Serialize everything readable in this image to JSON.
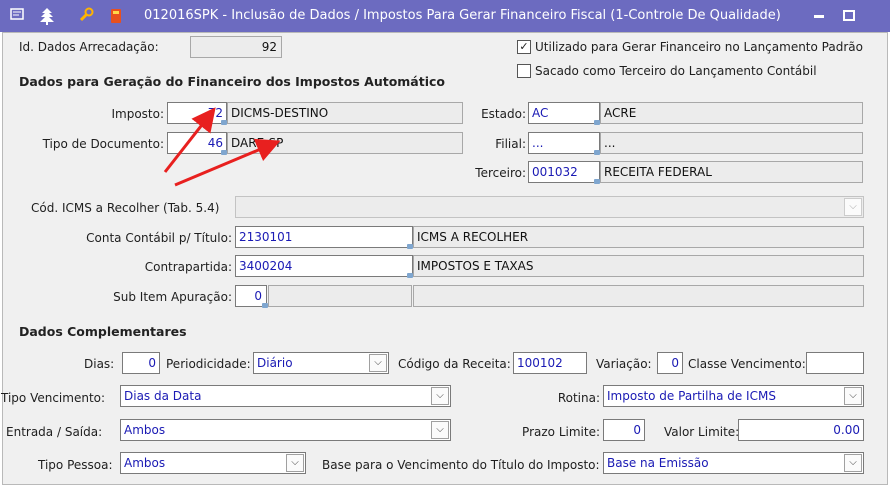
{
  "titlebar": {
    "title": "012016SPK - Inclusão de Dados / Impostos Para Gerar Financeiro Fiscal (1-Controle De Qualidade)",
    "icons": [
      "menu-icon",
      "tree-icon",
      "wrench-icon",
      "book-icon"
    ],
    "bg_color": "#6c6bc0"
  },
  "header": {
    "id_label": "Id. Dados Arrecadação:",
    "id_value": "92",
    "chk_utilizado_label": "Utilizado para Gerar Financeiro no Lançamento Padrão",
    "chk_utilizado_checked": true,
    "chk_sacado_label": "Sacado como Terceiro do Lançamento Contábil",
    "chk_sacado_checked": false
  },
  "auto": {
    "section_title": "Dados para Geração do Financeiro dos Impostos Automático",
    "imposto_label": "Imposto:",
    "imposto_code": "72",
    "imposto_desc": "DICMS-DESTINO",
    "tipodoc_label": "Tipo de Documento:",
    "tipodoc_code": "46",
    "tipodoc_desc": "DARE-SP",
    "estado_label": "Estado:",
    "estado_code": "AC",
    "estado_desc": "ACRE",
    "filial_label": "Filial:",
    "filial_code": "...",
    "filial_desc": "...",
    "terceiro_label": "Terceiro:",
    "terceiro_code": "001032",
    "terceiro_desc": "RECEITA FEDERAL",
    "icms_label": "Cód. ICMS a Recolher (Tab. 5.4)",
    "icms_value": "",
    "conta_label": "Conta Contábil p/ Título:",
    "conta_code": "2130101",
    "conta_desc": "ICMS A RECOLHER",
    "contra_label": "Contrapartida:",
    "contra_code": "3400204",
    "contra_desc": "IMPOSTOS E TAXAS",
    "subitem_label": "Sub Item Apuração:",
    "subitem_code": "0",
    "subitem_desc1": "",
    "subitem_desc2": ""
  },
  "comp": {
    "section_title": "Dados Complementares",
    "dias_label": "Dias:",
    "dias_value": "0",
    "periodicidade_label": "Periodicidade:",
    "periodicidade_value": "Diário",
    "codreceita_label": "Código da Receita:",
    "codreceita_value": "100102",
    "variacao_label": "Variação:",
    "variacao_value": "0",
    "classe_label": "Classe Vencimento:",
    "classe_value": "",
    "tipovenc_label": "Tipo Vencimento:",
    "tipovenc_value": "Dias da Data",
    "rotina_label": "Rotina:",
    "rotina_value": "Imposto de Partilha de ICMS",
    "entrada_label": "Entrada / Saída:",
    "entrada_value": "Ambos",
    "prazo_label": "Prazo Limite:",
    "prazo_value": "0",
    "valorlim_label": "Valor Limite:",
    "valorlim_value": "0.00",
    "tipopessoa_label": "Tipo Pessoa:",
    "tipopessoa_value": "Ambos",
    "base_label": "Base para o Vencimento do Título do Imposto:",
    "base_value": "Base na Emissão"
  },
  "annotation": {
    "arrow_color": "#e8201f"
  }
}
